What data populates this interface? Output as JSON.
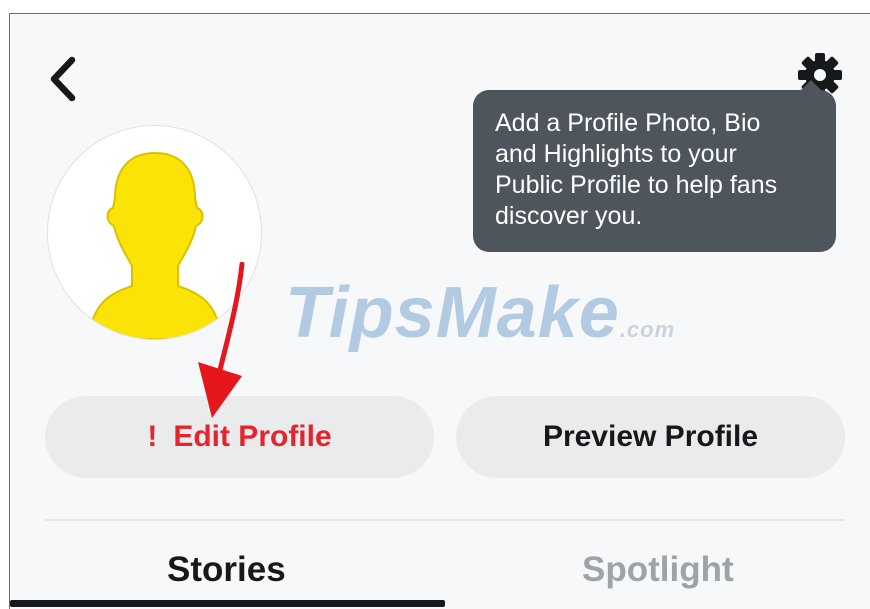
{
  "tooltip": {
    "lines": [
      "Add a Profile Photo, Bio",
      "and Highlights to your",
      "Public Profile to help fans",
      "discover you."
    ]
  },
  "watermark": {
    "brand": "TipsMake",
    "suffix": ".com"
  },
  "buttons": {
    "edit_profile_alert": "!",
    "edit_profile_label": "Edit Profile",
    "preview_profile_label": "Preview Profile"
  },
  "tabs": [
    {
      "label": "Stories",
      "active": true
    },
    {
      "label": "Spotlight",
      "active": false
    }
  ],
  "icons": {
    "back": "chevron-left-icon",
    "settings": "gear-icon",
    "avatar": "default-avatar-silhouette"
  },
  "colors": {
    "alert_red": "#e5252d",
    "tooltip_bg": "#4e555d",
    "avatar_yellow": "#fbe308",
    "pill_bg": "#e9ebed",
    "active_tab": "#16191c",
    "inactive_tab": "#9ea3a8"
  }
}
